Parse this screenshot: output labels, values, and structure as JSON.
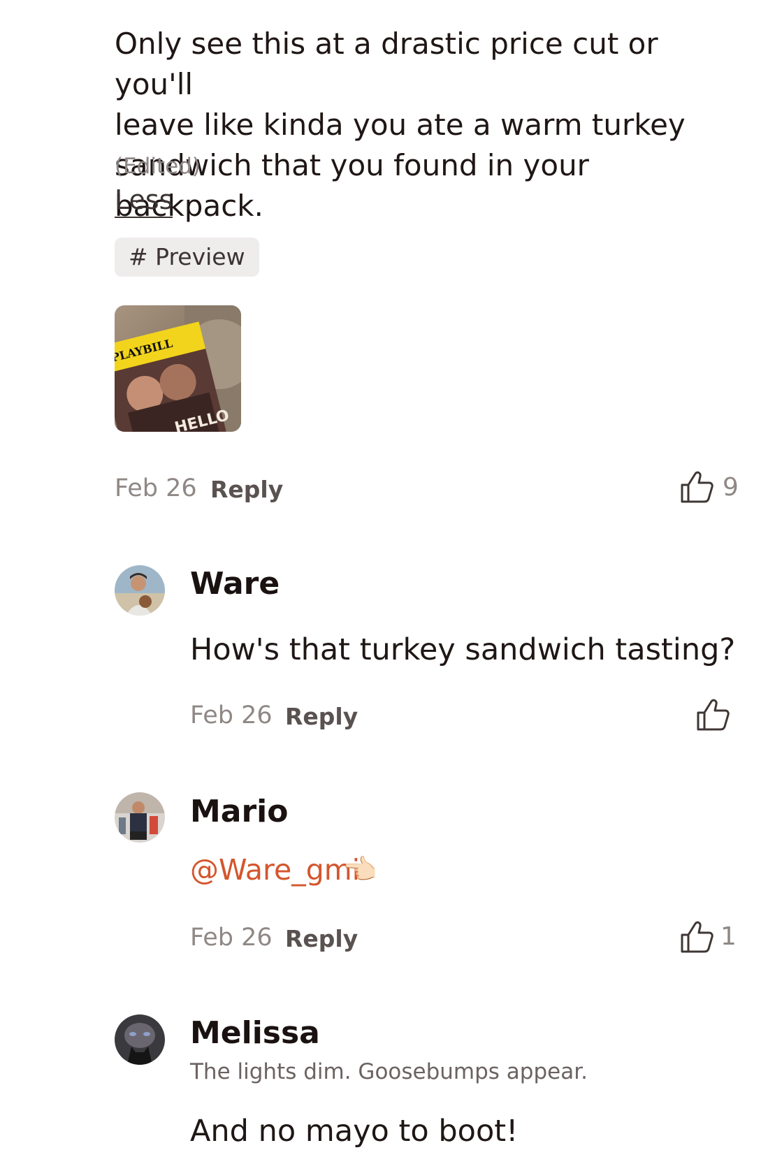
{
  "main_comment": {
    "body": "Only see this at a drastic price cut or you'll\nleave like kinda you ate a warm turkey\nsandwich that you found in your backpack.",
    "edited_label": "(Edited)",
    "less_label": "Less",
    "tag": "# Preview",
    "image": {
      "playbill_text": "PLAYBILL",
      "title_fragment": "HELLO"
    },
    "date": "Feb 26",
    "reply_label": "Reply",
    "like_count": "9"
  },
  "replies": [
    {
      "name": "Ware",
      "body": "How's that turkey sandwich tasting?",
      "date": "Feb 26",
      "reply_label": "Reply",
      "like_count": ""
    },
    {
      "name": "Mario",
      "mention": "@Ware_gmi",
      "emoji": "👈🏻",
      "date": "Feb 26",
      "reply_label": "Reply",
      "like_count": "1"
    },
    {
      "name": "Melissa",
      "tagline": "The lights dim. Goosebumps appear.",
      "body": "And no mayo to boot!"
    }
  ],
  "colors": {
    "mention": "#d4562e",
    "text": "#1f1715",
    "muted": "#8f8885"
  }
}
